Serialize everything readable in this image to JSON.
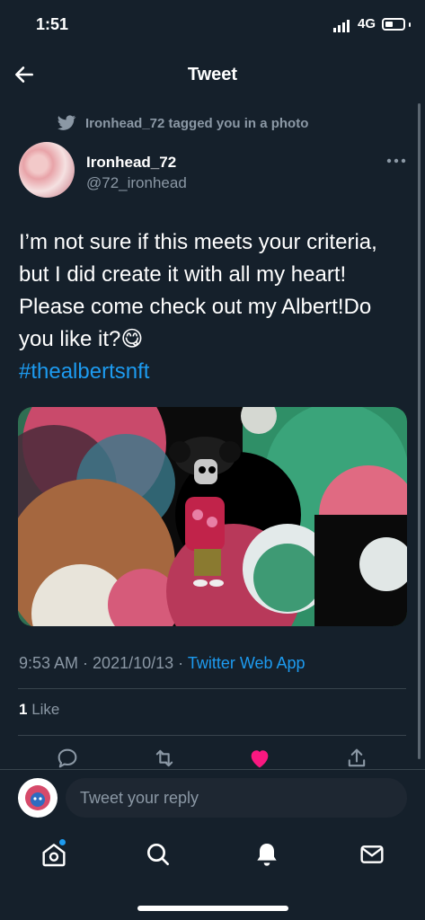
{
  "status_bar": {
    "time": "1:51",
    "network": "4G"
  },
  "header": {
    "title": "Tweet"
  },
  "tweet": {
    "social_context": "Ironhead_72 tagged you in a photo",
    "author": {
      "display_name": "Ironhead_72",
      "handle": "@72_ironhead"
    },
    "text": "I’m not sure if this meets your criteria, but I did create it with all my heart! Please come check out my Albert!Do you like it?😋",
    "hashtag": "#thealbertsnft",
    "meta": {
      "time": "9:53 AM",
      "separator": " · ",
      "date": "2021/10/13",
      "source": "Twitter Web App"
    },
    "likes": {
      "count": "1",
      "label": "Like"
    },
    "liked": true
  },
  "reply": {
    "placeholder": "Tweet your reply"
  },
  "bottom_nav": [
    "home-icon",
    "search-icon",
    "notifications-icon",
    "messages-icon"
  ],
  "colors": {
    "background": "#15202b",
    "accent": "#1d9bf0",
    "like": "#f91880",
    "muted": "#8b98a5"
  }
}
